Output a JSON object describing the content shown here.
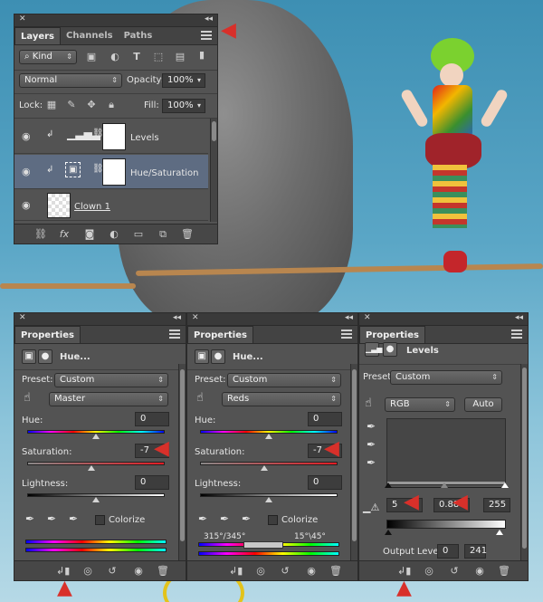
{
  "layers_panel": {
    "tabs": [
      "Layers",
      "Channels",
      "Paths"
    ],
    "kind_label": "Kind",
    "blend_mode": "Normal",
    "opacity_label": "Opacity:",
    "opacity_value": "100%",
    "lock_label": "Lock:",
    "fill_label": "Fill:",
    "fill_value": "100%",
    "layers": [
      {
        "name": "Levels"
      },
      {
        "name": "Hue/Saturation"
      },
      {
        "name": "Clown 1"
      }
    ]
  },
  "properties_hue_master": {
    "tab": "Properties",
    "title": "Hue...",
    "preset_label": "Preset:",
    "preset_value": "Custom",
    "channel": "Master",
    "hue_label": "Hue:",
    "hue_value": "0",
    "saturation_label": "Saturation:",
    "saturation_value": "-7",
    "lightness_label": "Lightness:",
    "lightness_value": "0",
    "colorize_label": "Colorize"
  },
  "properties_hue_reds": {
    "tab": "Properties",
    "title": "Hue...",
    "preset_label": "Preset:",
    "preset_value": "Custom",
    "channel": "Reds",
    "hue_label": "Hue:",
    "hue_value": "0",
    "saturation_label": "Saturation:",
    "saturation_value": "-7",
    "lightness_label": "Lightness:",
    "lightness_value": "0",
    "colorize_label": "Colorize",
    "range_left": "315°/345°",
    "range_right": "15°\\45°"
  },
  "properties_levels": {
    "tab": "Properties",
    "title": "Levels",
    "preset_label": "Preset:",
    "preset_value": "Custom",
    "channel": "RGB",
    "auto_label": "Auto",
    "input_black": "5",
    "input_gamma": "0.88",
    "input_white": "255",
    "output_label": "Output Levels:",
    "output_black": "0",
    "output_white": "241"
  },
  "colors": {
    "accent_red": "#d8302a",
    "panel_bg": "#535353",
    "selected_layer": "#5e6c82"
  }
}
